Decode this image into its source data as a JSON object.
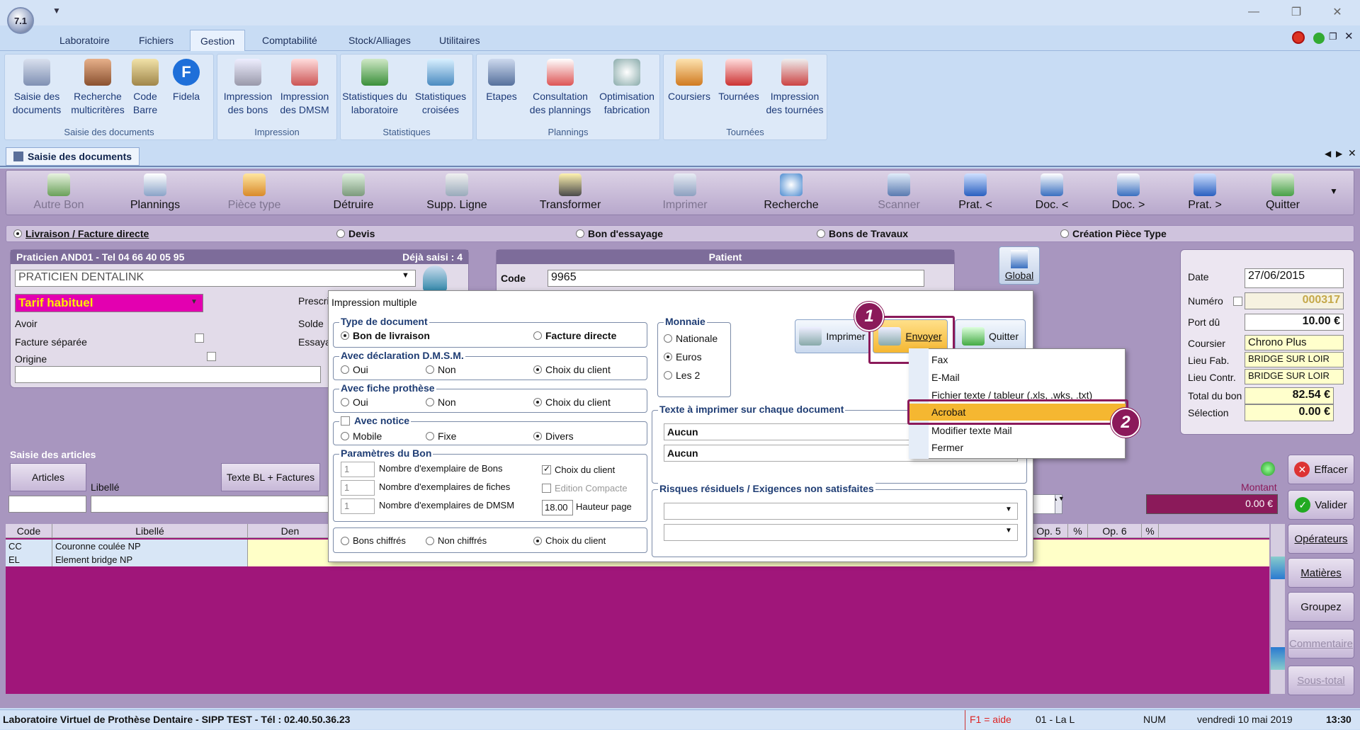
{
  "app": {
    "logo_text": "7.1"
  },
  "ribbon_tabs": [
    "Laboratoire",
    "Fichiers",
    "Gestion",
    "Comptabilité",
    "Stock/Alliages",
    "Utilitaires"
  ],
  "ribbon_groups": [
    {
      "title": "Saisie des documents",
      "buttons": [
        "Saisie des documents",
        "Recherche multicritères",
        "Code Barre",
        "Fidela"
      ]
    },
    {
      "title": "Impression",
      "buttons": [
        "Impression des bons",
        "Impression des DMSM"
      ]
    },
    {
      "title": "Statistiques",
      "buttons": [
        "Statistiques du laboratoire",
        "Statistiques croisées"
      ]
    },
    {
      "title": "Plannings",
      "buttons": [
        "Etapes",
        "Consultation des plannings",
        "Optimisation fabrication"
      ]
    },
    {
      "title": "Tournées",
      "buttons": [
        "Coursiers",
        "Tournées",
        "Impression des tournées"
      ]
    }
  ],
  "doc_tab": "Saisie des documents",
  "toolbar": [
    "Autre Bon",
    "Plannings",
    "Pièce type",
    "Détruire",
    "Supp. Ligne",
    "Transformer",
    "Imprimer",
    "Recherche",
    "Scanner",
    "Prat. <",
    "Doc. <",
    "Doc. >",
    "Prat. >",
    "Quitter"
  ],
  "doc_types": [
    "Livraison / Facture directe",
    "Devis",
    "Bon d'essayage",
    "Bons de Travaux",
    "Création Pièce Type"
  ],
  "praticien": {
    "header": "Praticien AND01 - Tel 04 66 40 05 95",
    "deja_saisi": "Déjà saisi : 4",
    "name": "PRATICIEN DENTALINK",
    "tarif": "Tarif habituel",
    "avoir": "Avoir",
    "facture_separee": "Facture séparée",
    "origine": "Origine",
    "prescri": "Prescri",
    "solde": "Solde",
    "essay": "Essaya"
  },
  "patient": {
    "header": "Patient",
    "code_label": "Code",
    "code": "9965",
    "global": "Global"
  },
  "summary": {
    "date_label": "Date",
    "date": "27/06/2015",
    "numero_label": "Numéro",
    "numero": "000317",
    "port_label": "Port dû",
    "port": "10.00 €",
    "coursier_label": "Coursier",
    "coursier": "Chrono Plus",
    "lieu_fab_label": "Lieu Fab.",
    "lieu_fab": "BRIDGE SUR LOIR",
    "lieu_contr_label": "Lieu Contr.",
    "lieu_contr": "BRIDGE SUR LOIR",
    "total_label": "Total du bon",
    "total": "82.54 €",
    "selection_label": "Sélection",
    "selection": "0.00 €"
  },
  "articles": {
    "section": "Saisie des articles",
    "articles_btn": "Articles",
    "texte_btn": "Texte BL + Factures",
    "libelle": "Libellé",
    "montant_label": "Montant",
    "montant": "0.00 €"
  },
  "grid": {
    "headers": [
      "Code",
      "Libellé",
      "Den",
      "Op. 5",
      "%",
      "Op. 6",
      "%"
    ],
    "rows": [
      [
        "CC",
        "Couronne coulée NP"
      ],
      [
        "EL",
        "Element bridge NP"
      ]
    ]
  },
  "side_buttons": [
    "Effacer",
    "Valider",
    "Opérateurs",
    "Matières",
    "Groupez",
    "Commentaire",
    "Sous-total"
  ],
  "dialog": {
    "title": "Impression multiple",
    "type_doc": {
      "legend": "Type de document",
      "opts": [
        "Bon de livraison",
        "Facture directe"
      ]
    },
    "dmsm": {
      "legend": "Avec déclaration D.M.S.M.",
      "opts": [
        "Oui",
        "Non",
        "Choix du client"
      ]
    },
    "prothese": {
      "legend": "Avec fiche prothèse",
      "opts": [
        "Oui",
        "Non",
        "Choix du client"
      ]
    },
    "notice": {
      "legend": "Avec notice",
      "opts": [
        "Mobile",
        "Fixe",
        "Divers"
      ]
    },
    "params": {
      "legend": "Paramètres du Bon",
      "bons_label": "Nombre d'exemplaire de Bons",
      "bons": "1",
      "fiches_label": "Nombre d'exemplaires de fiches",
      "fiches": "1",
      "dmsm_label": "Nombre d'exemplaires de DMSM",
      "dmsm": "1",
      "choix": "Choix du client",
      "edition": "Edition Compacte",
      "hauteur": "18.00",
      "hauteur_label": "Hauteur page"
    },
    "chiffres": [
      "Bons chiffrés",
      "Non chiffrés",
      "Choix du client"
    ],
    "monnaie": {
      "legend": "Monnaie",
      "opts": [
        "Nationale",
        "Euros",
        "Les 2"
      ]
    },
    "texte": {
      "legend": "Texte à imprimer sur chaque document",
      "v1": "Aucun",
      "v2": "Aucun"
    },
    "risques": {
      "legend": "Risques résiduels / Exigences non satisfaites"
    },
    "btn_imprimer": "Imprimer",
    "btn_envoyer": "Envoyer",
    "btn_quitter": "Quitter"
  },
  "menu": [
    "Fax",
    "E-Mail",
    "Fichier texte / tableur (.xls, .wks, .txt)",
    "Acrobat",
    "Modifier texte Mail",
    "Fermer"
  ],
  "badges": [
    "1",
    "2"
  ],
  "status": {
    "left": "Laboratoire Virtuel de Prothèse Dentaire - SIPP TEST - Tél : 02.40.50.36.23",
    "help": "F1 = aide",
    "site": "01 - La L",
    "num": "NUM",
    "date": "vendredi 10 mai 2019",
    "time": "13:30"
  },
  "colors": {
    "accent": "#8b1a5a",
    "grid_bg": "#a0167a",
    "work_bg": "#a896bf",
    "highlight": "#f5b731"
  }
}
